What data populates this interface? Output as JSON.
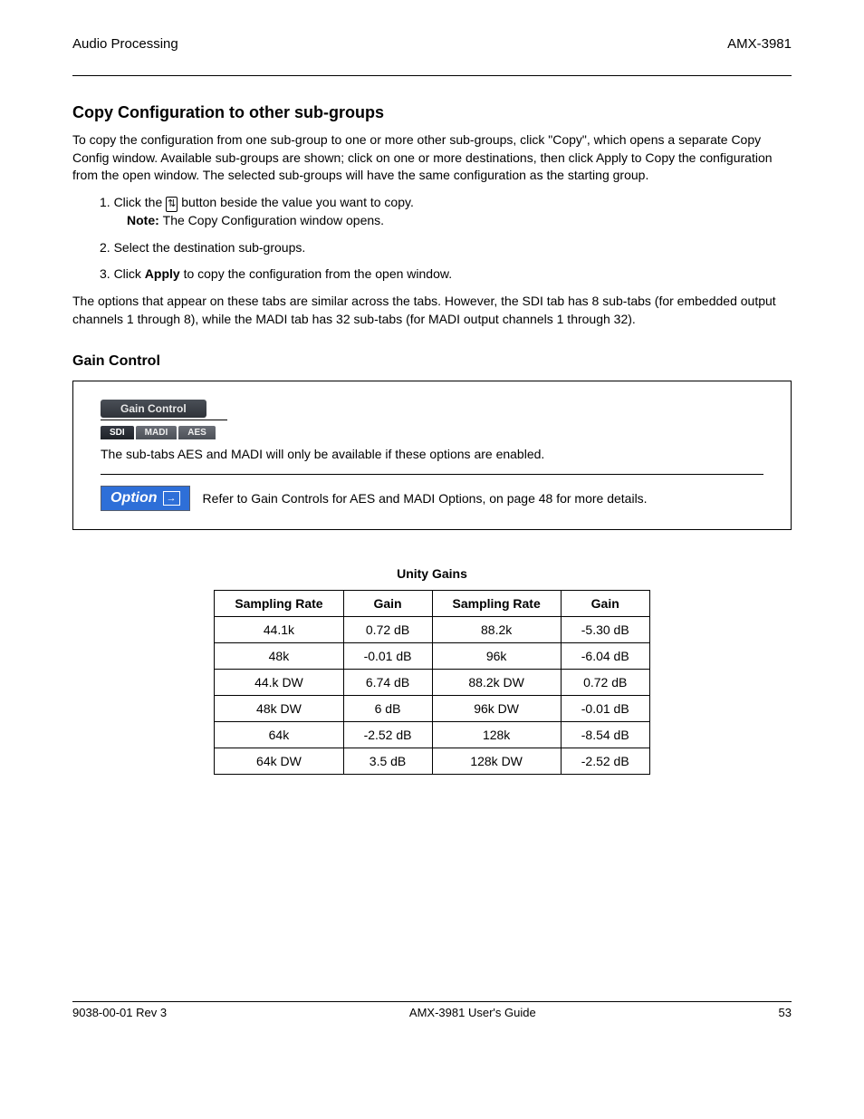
{
  "header": {
    "left": "Audio Processing",
    "right": "AMX-3981"
  },
  "section": {
    "title": "Copy Configuration to other sub-groups",
    "p1": "To copy the configuration from one sub-group to one or more other sub-groups, click \"Copy\", which opens a separate Copy Config window. Available sub-groups are shown; click on one or more destinations, then click Apply to Copy the configuration from the open window. The selected sub-groups will have the same configuration as the starting group.",
    "n1_prefix": "1. Click the ",
    "n1_suffix": " button beside the value you want to copy.",
    "n1_note_label": "Note: ",
    "n1_note": "The Copy Configuration window opens.",
    "n2": "2. Select the destination sub-groups.",
    "n3_prefix": "3. Click ",
    "n3_bold": "Apply",
    "n3_suffix": " to copy the configuration from the open window.",
    "p2": "The options that appear on these tabs are similar across the tabs. However, the SDI tab has 8 sub-tabs (for embedded output channels 1 through 8), while the MADI tab has 32 sub-tabs (for MADI output channels 1 through 32)."
  },
  "subsection_title": "Gain Control",
  "option_box": {
    "tab_main": "Gain Control",
    "subtab_sdi": "SDI",
    "subtab_madi": "MADI",
    "subtab_aes": "AES",
    "line1": "The sub-tabs AES and MADI will only be available if these options are enabled.",
    "option_label": "Option",
    "line2": "Refer to Gain Controls for AES and MADI Options, on page 48 for more details."
  },
  "table": {
    "caption": "Unity Gains",
    "headers": [
      "Sampling Rate",
      "Gain",
      "Sampling Rate",
      "Gain"
    ],
    "rows": [
      [
        "44.1k",
        "0.72 dB",
        "88.2k",
        "-5.30 dB"
      ],
      [
        "48k",
        "-0.01 dB",
        "96k",
        "-6.04 dB"
      ],
      [
        "44.k DW",
        "6.74 dB",
        "88.2k DW",
        "0.72 dB"
      ],
      [
        "48k DW",
        "6 dB",
        "96k DW",
        "-0.01 dB"
      ],
      [
        "64k",
        "-2.52 dB",
        "128k",
        "-8.54 dB"
      ],
      [
        "64k DW",
        "3.5 dB",
        "128k DW",
        "-2.52 dB"
      ]
    ]
  },
  "footer": {
    "left": "9038-00-01 Rev 3",
    "center": "AMX-3981 User's Guide",
    "right": "53"
  }
}
